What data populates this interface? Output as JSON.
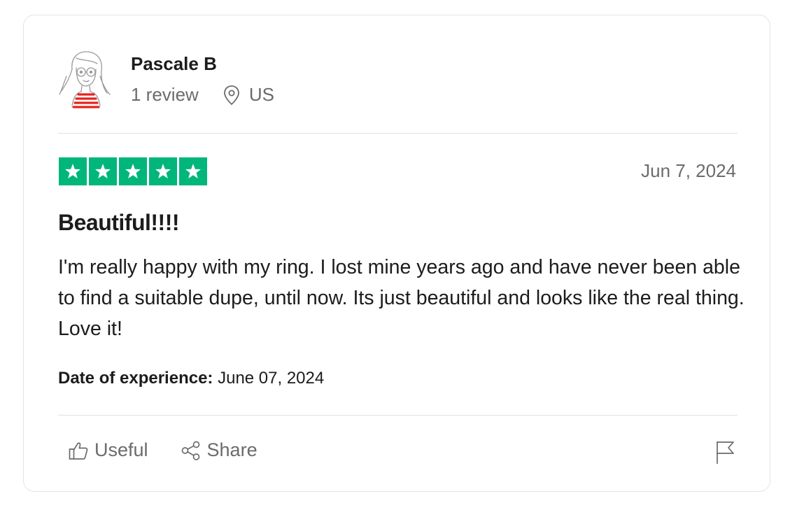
{
  "reviewer": {
    "name": "Pascale B",
    "review_count": "1 review",
    "country": "US"
  },
  "rating": {
    "stars": 5,
    "max": 5,
    "color": "#00b67a"
  },
  "review": {
    "date": "Jun 7, 2024",
    "title": "Beautiful!!!!",
    "body": "I'm really happy with my ring. I lost mine years ago and have never been able to find a suitable dupe, until now. Its just beautiful and looks like the real thing. Love it!",
    "experience_label": "Date of experience:",
    "experience_date": " June 07, 2024"
  },
  "actions": {
    "useful_label": "Useful",
    "share_label": "Share"
  },
  "icons": {
    "location": "location-pin-icon",
    "useful": "thumbs-up-icon",
    "share": "share-icon",
    "report": "flag-icon"
  }
}
